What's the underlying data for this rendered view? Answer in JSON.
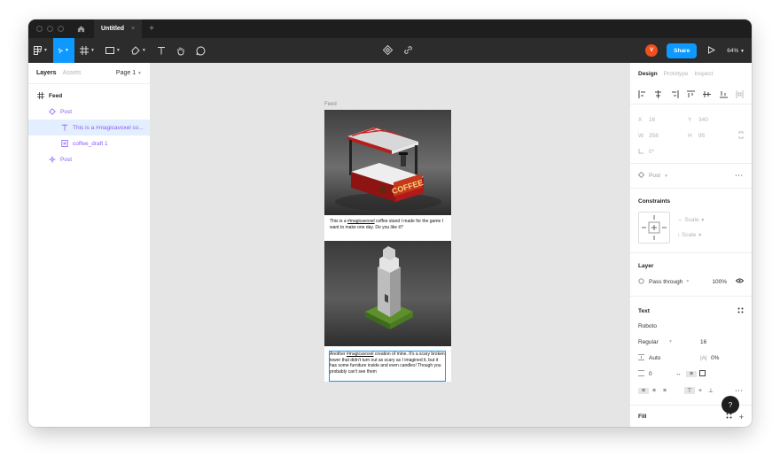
{
  "titlebar": {
    "doc_title": "Untitled",
    "close_glyph": "×",
    "new_tab_glyph": "+"
  },
  "toolbar": {
    "user_initial": "V",
    "share_label": "Share",
    "zoom_label": "64%"
  },
  "left_panel": {
    "tab_layers": "Layers",
    "tab_assets": "Assets",
    "page_label": "Page 1",
    "layers": [
      {
        "name": "Feed",
        "icon": "frame-icon"
      },
      {
        "name": "Post",
        "icon": "component-icon"
      },
      {
        "name": "This is a #magicavoxel co...",
        "icon": "text-icon"
      },
      {
        "name": "coffee_draft 1",
        "icon": "image-icon"
      },
      {
        "name": "Post",
        "icon": "component-icon"
      }
    ]
  },
  "canvas": {
    "frame_label": "Feed",
    "post1": {
      "prefix": "This is a ",
      "tag": "#magicavoxel",
      "suffix": " coffee stand I made for the game I want to make one day. Do you like it?",
      "sign_text": "COFFEE"
    },
    "post2": {
      "prefix": "Another ",
      "tag": "#magicavoxel",
      "suffix": " creation of mine. It's a scary broken tower that didn't turn out as scary as I imagined it, but it has some furniture inside and even candles! Though you probably can't see them"
    }
  },
  "right_panel": {
    "tab_design": "Design",
    "tab_prototype": "Prototype",
    "tab_inspect": "Inspect",
    "x_label": "X",
    "x_value": "16",
    "y_label": "Y",
    "y_value": "340",
    "w_label": "W",
    "w_value": "358",
    "h_label": "H",
    "h_value": "95",
    "rotation_value": "0°",
    "component_name": "Post",
    "constraints_title": "Constraints",
    "h_constraint": "Scale",
    "v_constraint": "Scale",
    "layer_title": "Layer",
    "blend_mode": "Pass through",
    "opacity": "100%",
    "text_title": "Text",
    "font_family": "Roboto",
    "font_weight": "Regular",
    "font_size": "16",
    "line_height": "Auto",
    "letter_spacing": "0%",
    "paragraph_spacing": "0",
    "fill_title": "Fill",
    "help_glyph": "?"
  },
  "colors": {
    "accent": "#0d99ff",
    "toolbar_bg": "#2c2c2c",
    "titlebar_bg": "#1e1e1e",
    "canvas_bg": "#e5e5e5",
    "selection_bg": "#e3efff",
    "component_purple": "#8a5cf6",
    "avatar": "#f24e1e"
  }
}
